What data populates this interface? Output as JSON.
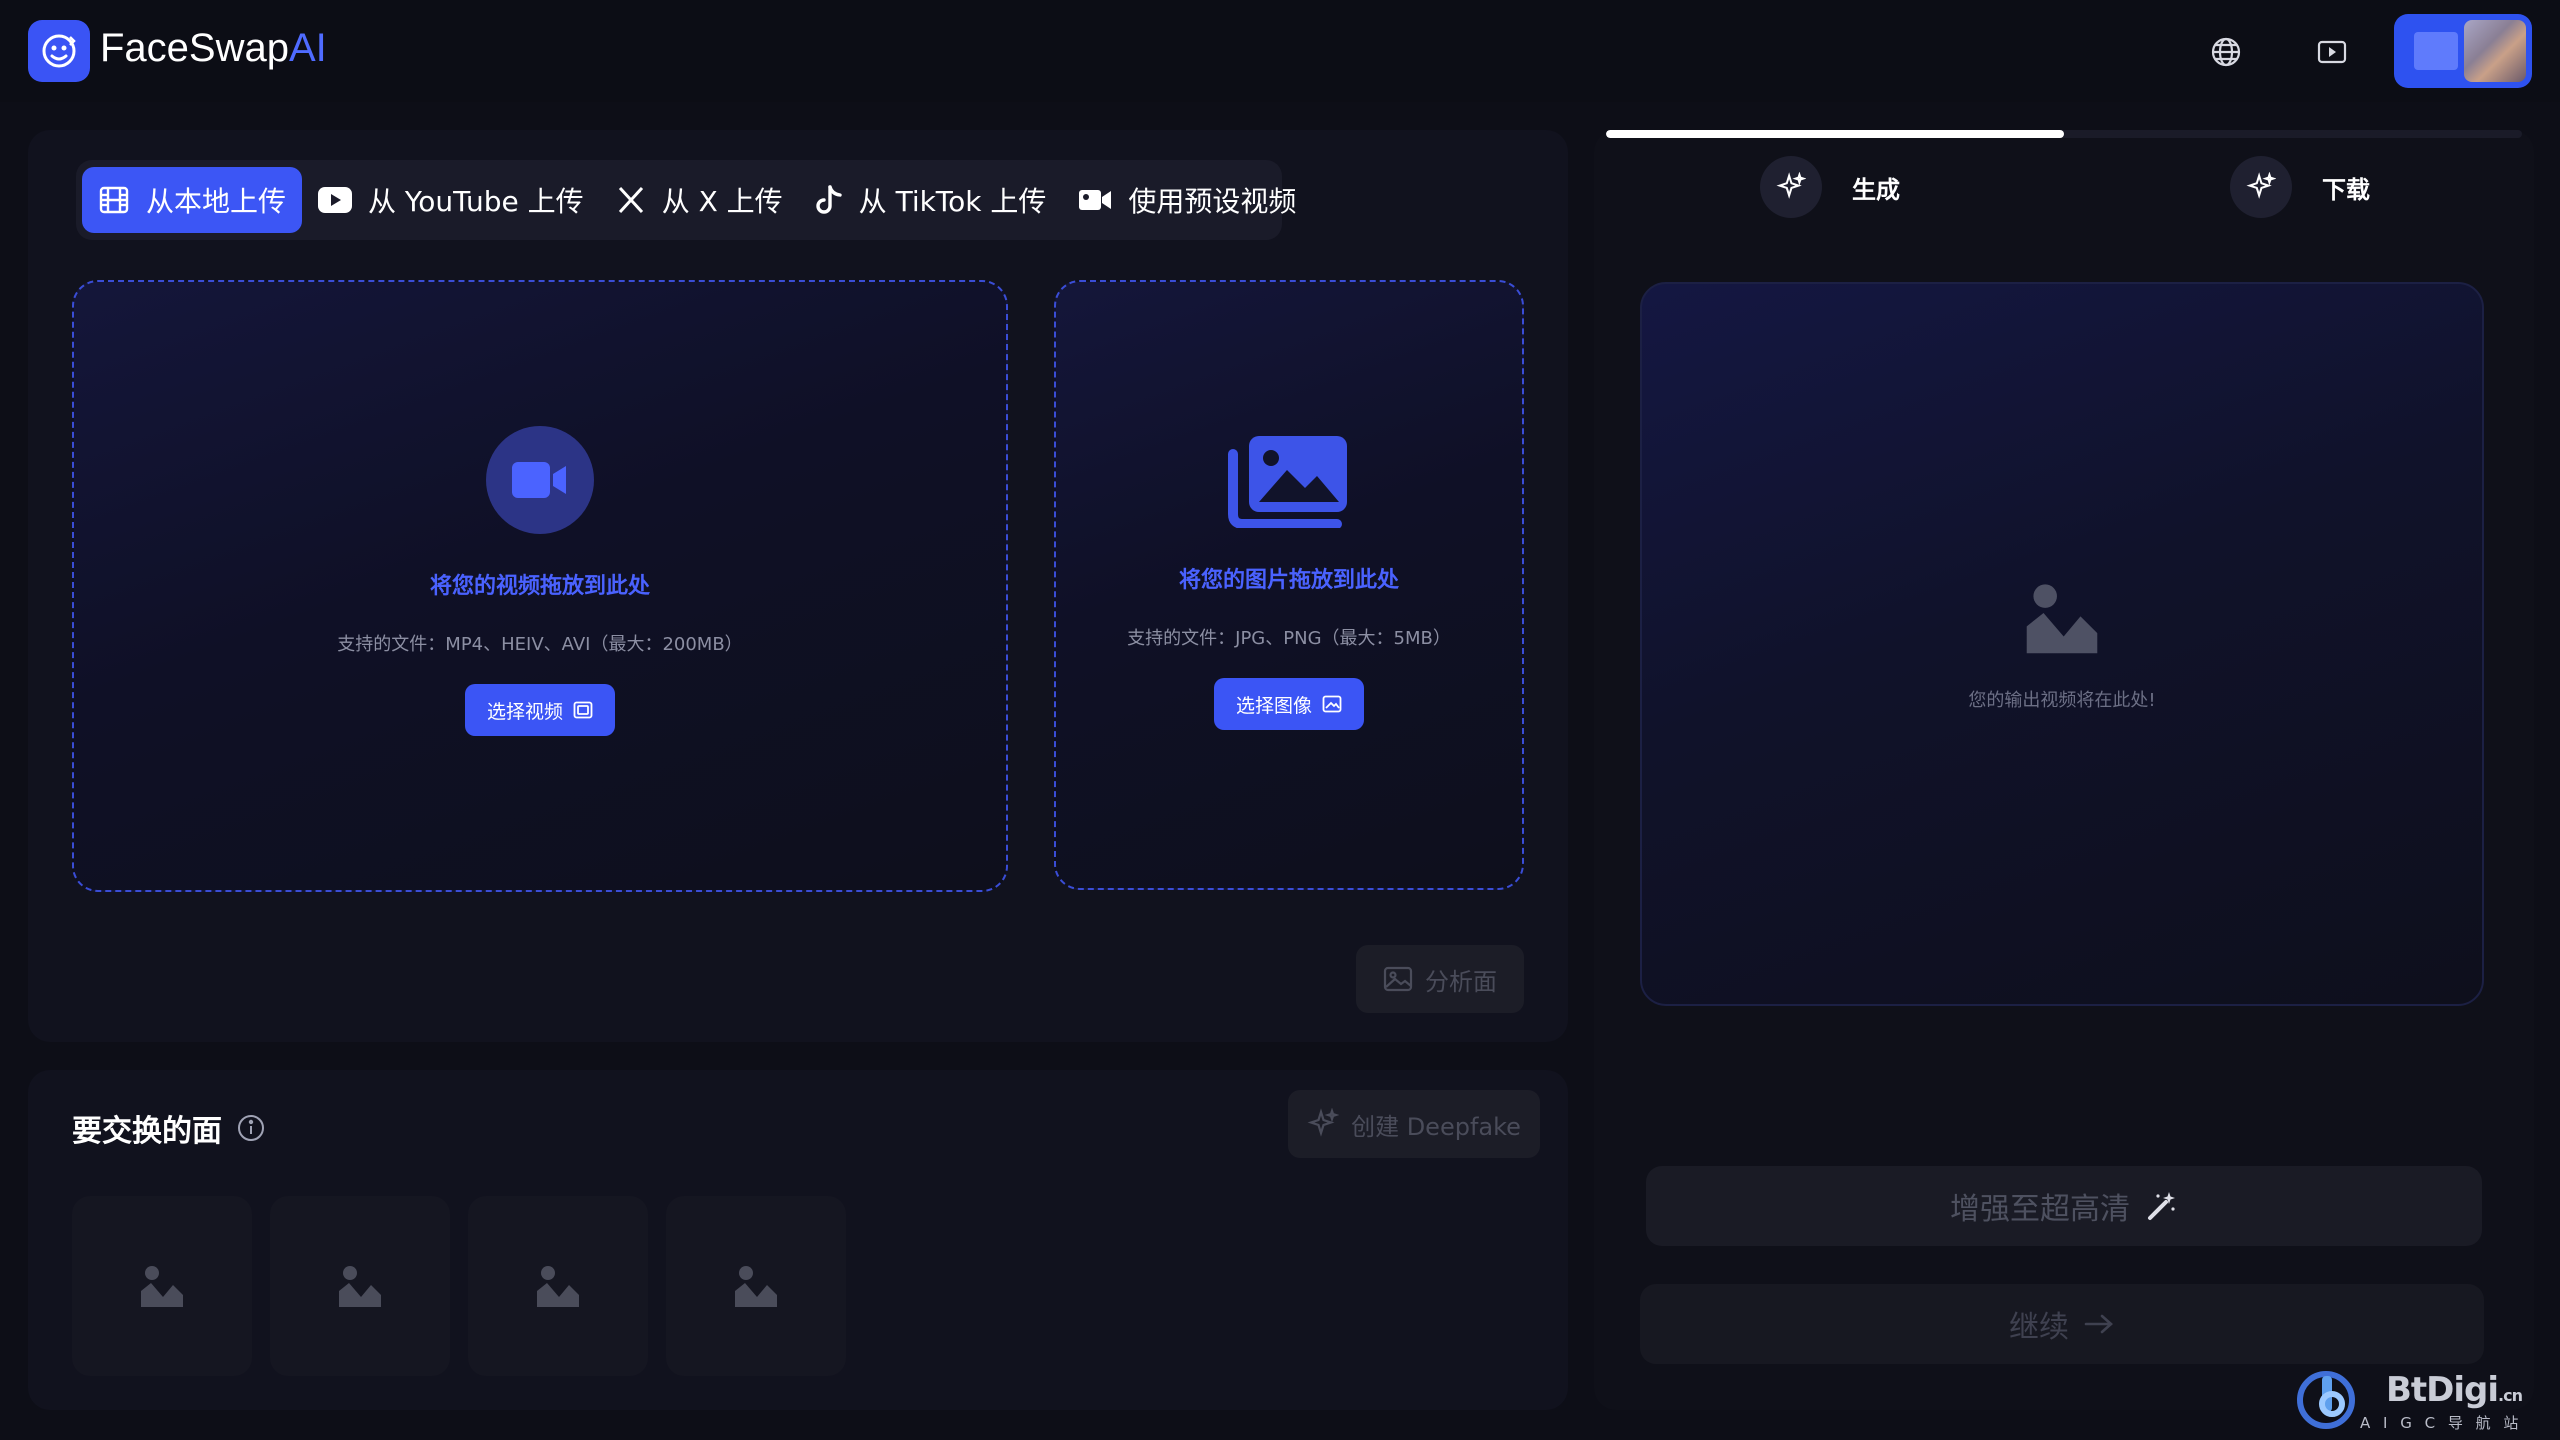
{
  "header": {
    "brand_main": "FaceSwap",
    "brand_accent": "AI",
    "icons": [
      "globe-icon",
      "video-library-icon"
    ]
  },
  "upload": {
    "tabs": [
      {
        "label": "从本地上传",
        "icon": "film-icon",
        "active": true
      },
      {
        "label": "从 YouTube 上传",
        "icon": "youtube-icon",
        "active": false
      },
      {
        "label": "从 X 上传",
        "icon": "x-logo-icon",
        "active": false
      },
      {
        "label": "从 TikTok 上传",
        "icon": "tiktok-icon",
        "active": false
      },
      {
        "label": "使用预设视频",
        "icon": "video-camera-icon",
        "active": false
      }
    ],
    "video": {
      "title": "将您的视频拖放到此处",
      "subtitle": "支持的文件：MP4、HEIV、AVI（最大：200MB）",
      "button": "选择视频"
    },
    "image": {
      "title": "将您的图片拖放到此处",
      "subtitle": "支持的文件：JPG、PNG（最大：5MB）",
      "button": "选择图像"
    },
    "analyze_button": "分析面"
  },
  "faces": {
    "title": "要交换的面",
    "create_button": "创建 Deepfake",
    "slot_count": 4
  },
  "output": {
    "progress": 0.5,
    "steps": [
      {
        "label": "生成",
        "icon": "sparkle-icon"
      },
      {
        "label": "下载",
        "icon": "sparkle-icon"
      }
    ],
    "placeholder": "您的输出视频将在此处!",
    "enhance_button": "增强至超高清",
    "continue_button": "继续"
  },
  "watermark": {
    "text": "BtDigi",
    "suffix": ".cn",
    "tagline": "A I G C 导 航 站"
  },
  "colors": {
    "accent": "#3c56f5",
    "background": "#0d0e17",
    "panel": "#11121e"
  }
}
